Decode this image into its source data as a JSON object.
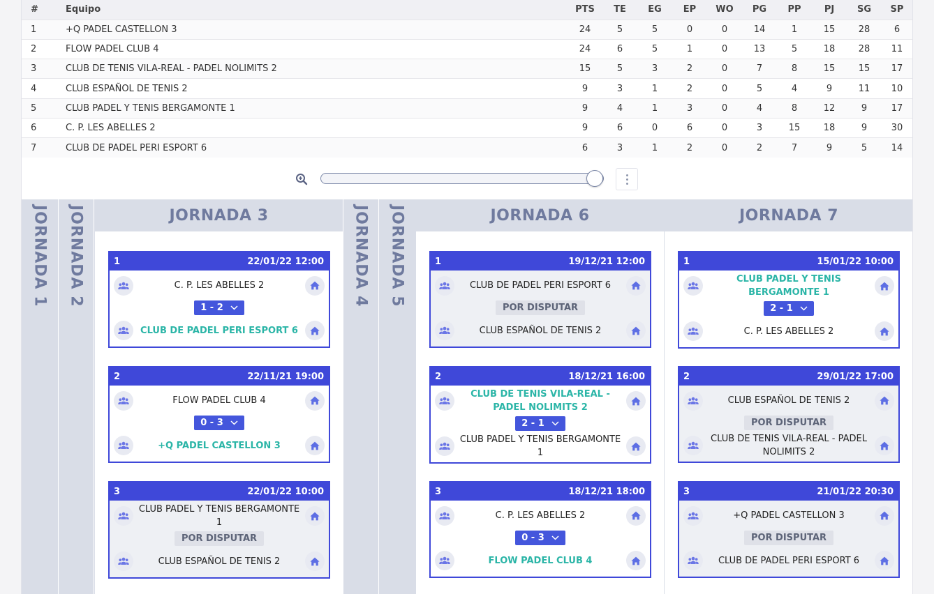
{
  "standings": {
    "headers": [
      "#",
      "Equipo",
      "PTS",
      "TE",
      "EG",
      "EP",
      "WO",
      "PG",
      "PP",
      "PJ",
      "SG",
      "SP"
    ],
    "rows": [
      [
        "1",
        "+Q PADEL CASTELLON 3",
        "24",
        "5",
        "5",
        "0",
        "0",
        "14",
        "1",
        "15",
        "28",
        "6"
      ],
      [
        "2",
        "FLOW PADEL CLUB 4",
        "24",
        "6",
        "5",
        "1",
        "0",
        "13",
        "5",
        "18",
        "28",
        "11"
      ],
      [
        "3",
        "CLUB DE TENIS VILA-REAL - PADEL NOLIMITS 2",
        "15",
        "5",
        "3",
        "2",
        "0",
        "7",
        "8",
        "15",
        "15",
        "17"
      ],
      [
        "4",
        "CLUB ESPAÑOL DE TENIS 2",
        "9",
        "3",
        "1",
        "2",
        "0",
        "5",
        "4",
        "9",
        "11",
        "10"
      ],
      [
        "5",
        "CLUB PADEL Y TENIS BERGAMONTE 1",
        "9",
        "4",
        "1",
        "3",
        "0",
        "4",
        "8",
        "12",
        "9",
        "17"
      ],
      [
        "6",
        "C. P. LES ABELLES 2",
        "9",
        "6",
        "0",
        "6",
        "0",
        "3",
        "15",
        "18",
        "9",
        "30"
      ],
      [
        "7",
        "CLUB DE PADEL PERI ESPORT 6",
        "6",
        "3",
        "1",
        "2",
        "0",
        "2",
        "7",
        "9",
        "5",
        "14"
      ]
    ]
  },
  "icons": {
    "zoom": "zoom-in-icon",
    "menu": "more-vertical-icon",
    "team": "users-icon",
    "home": "home-icon",
    "dropdown": "chevron-down-icon"
  },
  "colors": {
    "accent": "#3f48d9",
    "winner": "#2bb5a7",
    "header_bg": "#d9dde7",
    "header_text": "#6f7a9e"
  },
  "zoom": {
    "level": 1.0
  },
  "jornadas": {
    "j1": "JORNADA 1",
    "j2": "JORNADA 2",
    "j3": {
      "title": "JORNADA 3",
      "matches": [
        {
          "num": "1",
          "date": "22/01/22 12:00",
          "home": "C. P. LES ABELLES 2",
          "away": "CLUB DE PADEL PERI ESPORT 6",
          "result": "1 - 2"
        },
        {
          "num": "2",
          "date": "22/11/21 19:00",
          "home": "FLOW PADEL CLUB 4",
          "away": "+Q PADEL CASTELLON 3",
          "result": "0 - 3"
        },
        {
          "num": "3",
          "date": "22/01/22 10:00",
          "home": "CLUB PADEL Y TENIS BERGAMONTE 1",
          "away": "CLUB ESPAÑOL DE TENIS 2",
          "result": "POR DISPUTAR"
        }
      ]
    },
    "j4": "JORNADA 4",
    "j5": "JORNADA 5",
    "j6": {
      "title": "JORNADA 6",
      "matches": [
        {
          "num": "1",
          "date": "19/12/21 12:00",
          "home": "CLUB DE PADEL PERI ESPORT 6",
          "away": "CLUB ESPAÑOL DE TENIS 2",
          "result": "POR DISPUTAR"
        },
        {
          "num": "2",
          "date": "18/12/21 16:00",
          "home": "CLUB DE TENIS VILA-REAL - PADEL NOLIMITS 2",
          "away": "CLUB PADEL Y TENIS BERGAMONTE 1",
          "result": "2 - 1"
        },
        {
          "num": "3",
          "date": "18/12/21 18:00",
          "home": "C. P. LES ABELLES 2",
          "away": "FLOW PADEL CLUB 4",
          "result": "0 - 3"
        }
      ]
    },
    "j7": {
      "title": "JORNADA 7",
      "matches": [
        {
          "num": "1",
          "date": "15/01/22 10:00",
          "home": "CLUB PADEL Y TENIS BERGAMONTE 1",
          "away": "C. P. LES ABELLES 2",
          "result": "2 - 1"
        },
        {
          "num": "2",
          "date": "29/01/22 17:00",
          "home": "CLUB ESPAÑOL DE TENIS 2",
          "away": "CLUB DE TENIS VILA-REAL - PADEL NOLIMITS 2",
          "result": "POR DISPUTAR"
        },
        {
          "num": "3",
          "date": "21/01/22 20:30",
          "home": "+Q PADEL CASTELLON 3",
          "away": "CLUB DE PADEL PERI ESPORT 6",
          "result": "POR DISPUTAR"
        }
      ]
    }
  }
}
